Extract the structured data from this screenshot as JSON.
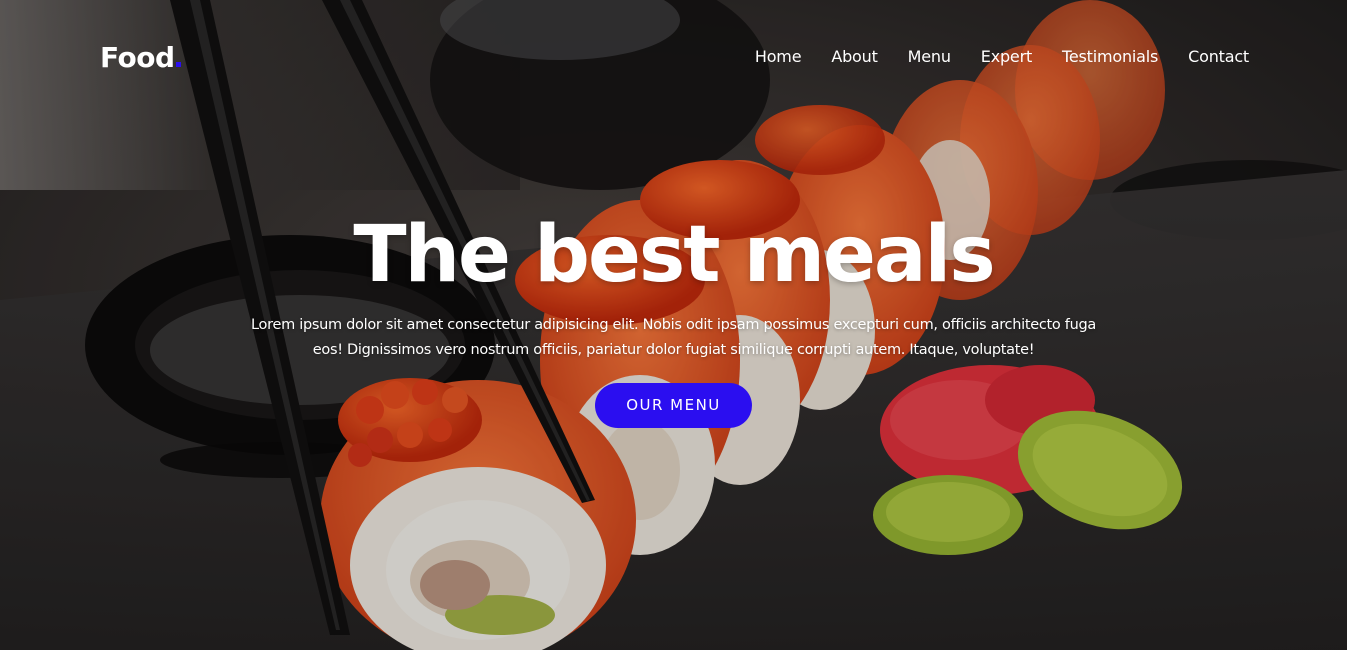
{
  "navbar": {
    "brand": "Food",
    "brand_dot_color": "#2b0ef0",
    "links": [
      {
        "label": "Home"
      },
      {
        "label": "About"
      },
      {
        "label": "Menu"
      },
      {
        "label": "Expert"
      },
      {
        "label": "Testimonials"
      },
      {
        "label": "Contact"
      }
    ]
  },
  "hero": {
    "title": "The best meals",
    "text": "Lorem ipsum dolor sit amet consectetur adipisicing elit. Nobis odit ipsam possimus excepturi cum, officiis architecto fuga eos! Dignissimos vero nostrum officiis, pariatur dolor fugiat similique corrupti autem. Itaque, voluptate!",
    "cta_label": "OUR MENU",
    "cta_color": "#2b0ef0"
  }
}
